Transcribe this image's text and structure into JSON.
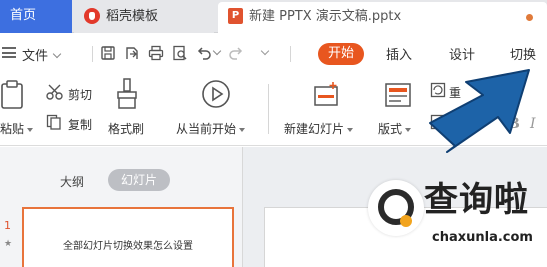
{
  "tabbar": {
    "home": "首页",
    "template_tab": "稻壳模板",
    "doc_tab": "新建 PPTX 演示文稿.pptx",
    "doc_icon": "P"
  },
  "menubar": {
    "file": "文件",
    "tabs": [
      "开始",
      "插入",
      "设计",
      "切换"
    ]
  },
  "ribbon": {
    "paste": "粘贴",
    "cut": "剪切",
    "copy": "复制",
    "format_painter": "格式刷",
    "play_from_current": "从当前开始",
    "new_slide": "新建幻灯片",
    "layout": "版式",
    "partial_label": "重"
  },
  "panel": {
    "outline_tab": "大纲",
    "slides_tab": "幻灯片",
    "slide_number": "1",
    "slide_title": "全部幻灯片切换效果怎么设置"
  },
  "watermark": {
    "title": "查询啦",
    "url": "chaxunla.com"
  },
  "colors": {
    "accent_orange": "#e8561f",
    "home_tab_blue": "#3d6fe0",
    "arrow_blue": "#1d63a8"
  }
}
